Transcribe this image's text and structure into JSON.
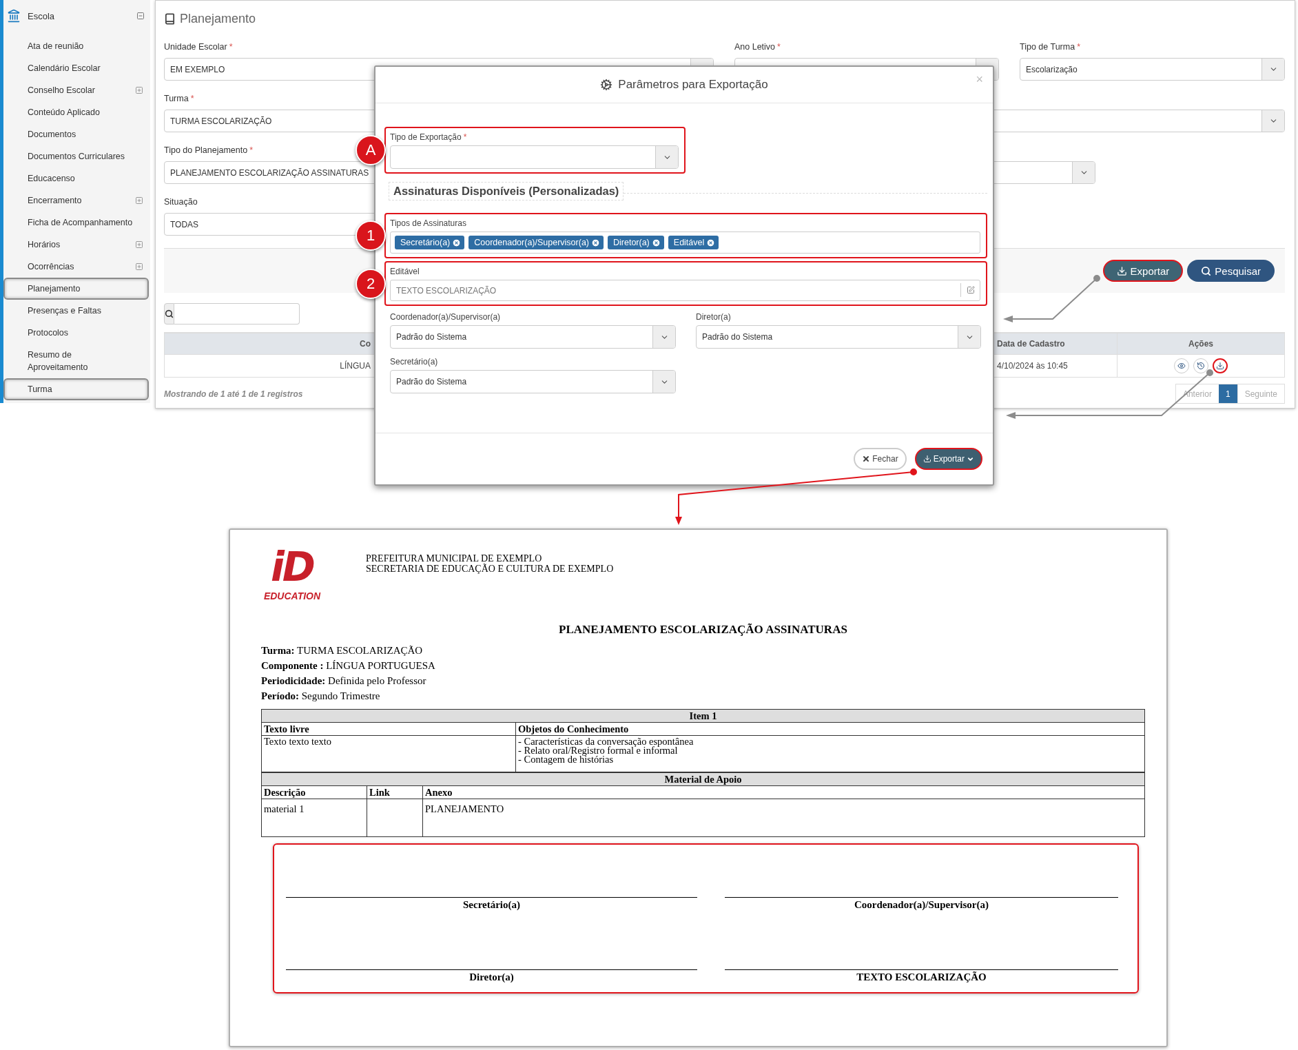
{
  "sidebar": {
    "title": "Escola",
    "items": [
      {
        "label": "Ata de reunião",
        "expandable": false,
        "highlighted": false
      },
      {
        "label": "Calendário Escolar",
        "expandable": false,
        "highlighted": false
      },
      {
        "label": "Conselho Escolar",
        "expandable": true,
        "highlighted": false
      },
      {
        "label": "Conteúdo Aplicado",
        "expandable": false,
        "highlighted": false
      },
      {
        "label": "Documentos",
        "expandable": false,
        "highlighted": false
      },
      {
        "label": "Documentos Curriculares",
        "expandable": false,
        "highlighted": false
      },
      {
        "label": "Educacenso",
        "expandable": false,
        "highlighted": false
      },
      {
        "label": "Encerramento",
        "expandable": true,
        "highlighted": false
      },
      {
        "label": "Ficha de Acompanhamento",
        "expandable": false,
        "highlighted": false
      },
      {
        "label": "Horários",
        "expandable": true,
        "highlighted": false
      },
      {
        "label": "Ocorrências",
        "expandable": true,
        "highlighted": false
      },
      {
        "label": "Planejamento",
        "expandable": false,
        "highlighted": true
      },
      {
        "label": "Presenças e Faltas",
        "expandable": false,
        "highlighted": false
      },
      {
        "label": "Protocolos",
        "expandable": false,
        "highlighted": false
      },
      {
        "label": "Resumo de\nAproveitamento",
        "expandable": false,
        "highlighted": false
      },
      {
        "label": "Turma",
        "expandable": false,
        "highlighted": true
      }
    ]
  },
  "main": {
    "title": "Planejamento",
    "form_rows": [
      [
        {
          "label": "Unidade Escolar",
          "required_mark": "*",
          "kind": "select",
          "value": "EM EXEMPLO"
        },
        {
          "label": "Ano Letivo",
          "required_mark": "*",
          "kind": "select"
        },
        {
          "label": "Tipo de Turma",
          "required_mark": "*",
          "kind": "select",
          "value": "Escolarização"
        }
      ],
      [
        {
          "label": "Turma",
          "required_mark": "*",
          "kind": "select",
          "value": "TURMA ESCOLARIZAÇÃO"
        }
      ],
      [
        {
          "label": "Tipo do Planejamento",
          "required_mark": "*",
          "kind": "select",
          "value": "PLANEJAMENTO ESCOLARIZAÇÃO ASSINATURAS"
        }
      ],
      [
        {
          "label": "Situação",
          "kind": "text",
          "value": "TODAS"
        }
      ]
    ],
    "actions": [
      {
        "label": "Exportar",
        "kind": "export",
        "highlighted": true
      },
      {
        "label": "Pesquisar",
        "kind": "search",
        "highlighted": false
      }
    ],
    "table": {
      "columns": [
        "Co",
        "Data de Cadastro",
        "Ações"
      ],
      "rows": [
        {
          "cells": [
            "LÍNGUA",
            "4/10/2024 às 10:45"
          ],
          "actions": [
            {
              "kind": "view",
              "highlighted": false
            },
            {
              "kind": "history",
              "highlighted": false
            },
            {
              "kind": "download",
              "highlighted": true
            }
          ]
        }
      ]
    },
    "summary": "Mostrando de 1 até 1 de 1 registros",
    "pagination": {
      "previous": "Anterior",
      "pages": [
        {
          "label": "1",
          "selected": true
        }
      ],
      "next": "Seguinte"
    }
  },
  "modal": {
    "title": "Parâmetros para Exportação",
    "close": "×",
    "export_type": {
      "label": "Tipo de Exportação",
      "required_mark": "*",
      "highlighted": true,
      "callout": "A"
    },
    "section_title": "Assinaturas Disponíveis (Personalizadas)",
    "signature_types": {
      "label": "Tipos de Assinaturas",
      "highlighted": true,
      "callout": "1",
      "tags": [
        "Secretário(a)",
        "Coordenador(a)/Supervisor(a)",
        "Diretor(a)",
        "Editável"
      ]
    },
    "editable": {
      "label": "Editável",
      "placeholder": "TEXTO ESCOLARIZAÇÃO",
      "highlighted": true,
      "callout": "2"
    },
    "selects": [
      {
        "label": "Coordenador(a)/Supervisor(a)",
        "value": "Padrão do Sistema"
      },
      {
        "label": "Diretor(a)",
        "value": "Padrão do Sistema"
      },
      {
        "label": "Secretário(a)",
        "value": "Padrão do Sistema"
      }
    ],
    "buttons": [
      {
        "label": "Fechar",
        "kind": "close",
        "highlighted": false
      },
      {
        "label": "Exportar",
        "kind": "export",
        "highlighted": true
      }
    ]
  },
  "document": {
    "logo": {
      "mark": "iD",
      "word": "EDUCATION"
    },
    "header": [
      "PREFEITURA MUNICIPAL DE EXEMPLO",
      "SECRETARIA DE EDUCAÇÃO E CULTURA DE EXEMPLO"
    ],
    "title": "PLANEJAMENTO ESCOLARIZAÇÃO ASSINATURAS",
    "info": [
      "**Turma:** TURMA ESCOLARIZAÇÃO",
      "**Componente :** LÍNGUA PORTUGUESA",
      "**Periodicidade:** Definida pelo Professor",
      "**Período:** Segundo Trimestre"
    ],
    "item": {
      "title": "Item 1",
      "columns": [
        "Texto livre",
        "Objetos do Conhecimento"
      ],
      "cells": [
        "Texto texto texto",
        [
          "- Características da conversação espontânea",
          "- Relato oral/Registro formal e informal",
          "- Contagem de histórias"
        ]
      ]
    },
    "material": {
      "title": "Material de Apoio",
      "columns": [
        "Descrição",
        "Link",
        "Anexo"
      ],
      "rows": [
        [
          "material 1",
          null,
          "PLANEJAMENTO"
        ]
      ]
    },
    "signatures": {
      "highlighted": true,
      "labels": [
        "Secretário(a)",
        "Coordenador(a)/Supervisor(a)",
        "Diretor(a)",
        "TEXTO ESCOLARIZAÇÃO"
      ]
    }
  }
}
